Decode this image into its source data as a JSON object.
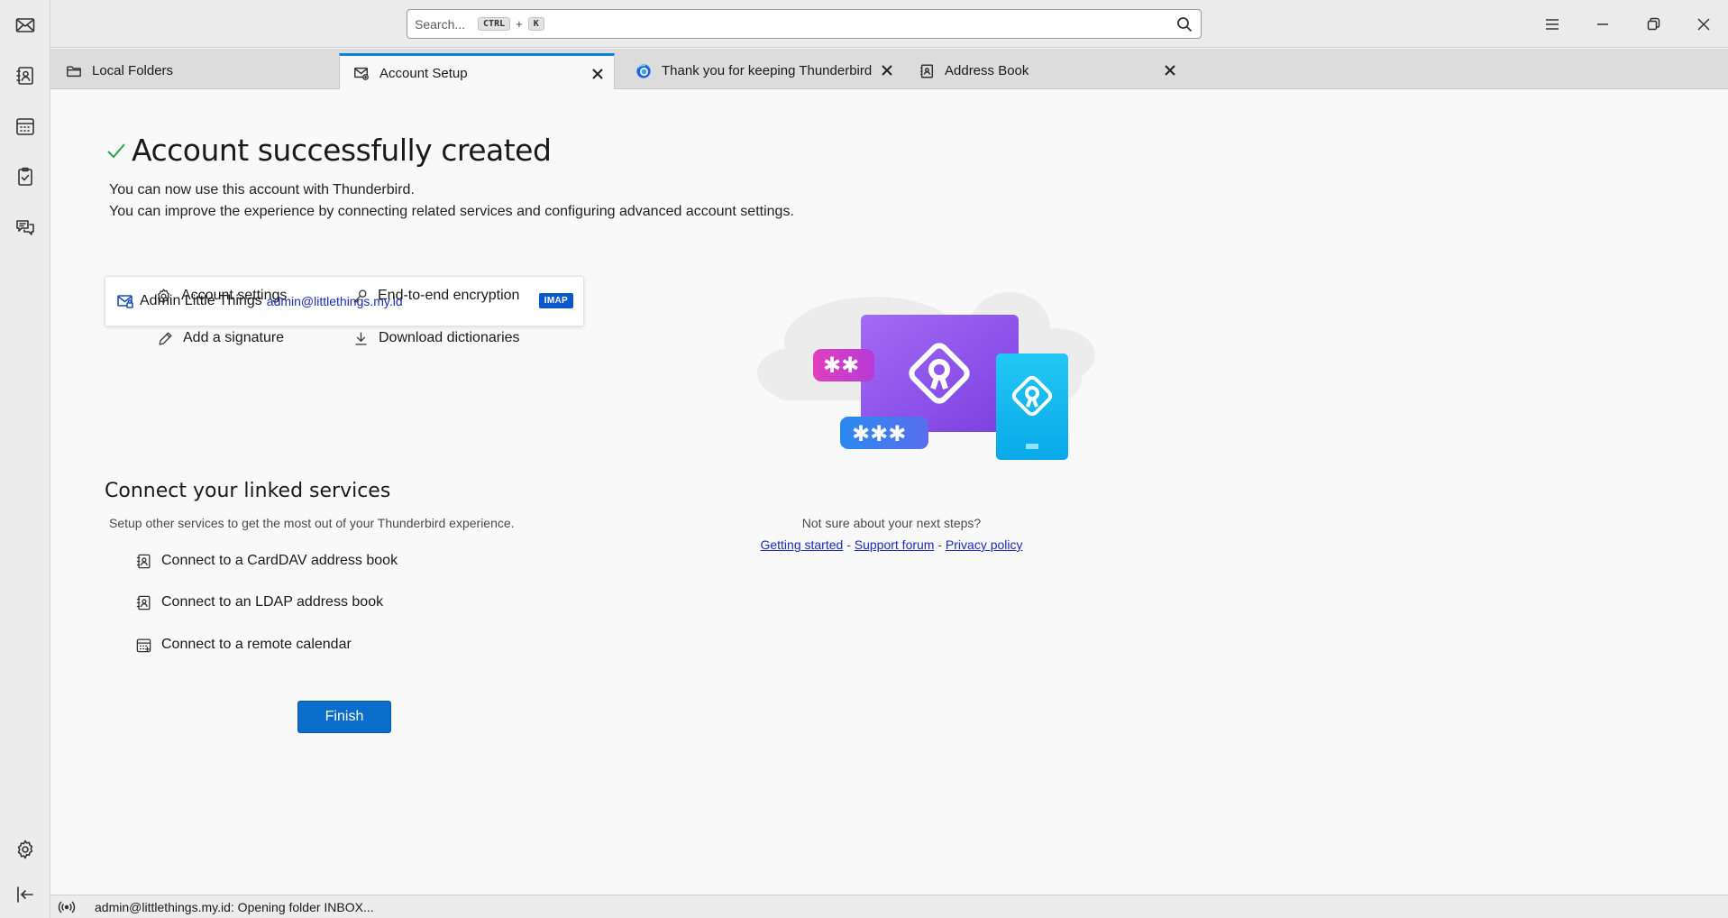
{
  "search": {
    "placeholder": "Search...",
    "shortcut_ctrl": "CTRL",
    "shortcut_plus": "+",
    "shortcut_key": "K"
  },
  "spaces": [
    {
      "name": "mail-space-button",
      "icon": "envelope-icon"
    },
    {
      "name": "address-book-space-button",
      "icon": "address-book-icon"
    },
    {
      "name": "calendar-space-button",
      "icon": "calendar-icon"
    },
    {
      "name": "tasks-space-button",
      "icon": "clipboard-check-icon"
    },
    {
      "name": "chat-space-button",
      "icon": "chat-bubbles-icon"
    },
    {
      "name": "settings-space-button",
      "icon": "gear-icon"
    },
    {
      "name": "collapse-spaces-button",
      "icon": "collapse-left-icon"
    }
  ],
  "tabs": [
    {
      "label": "Local Folders",
      "icon": "folder-icon",
      "active": false
    },
    {
      "label": "Account Setup",
      "icon": "account-setup-icon",
      "active": true
    },
    {
      "label": "Thank you for keeping Thunderbird",
      "icon": "thunderbird-logo-icon",
      "active": false
    },
    {
      "label": "Address Book",
      "icon": "address-book-icon",
      "active": false
    }
  ],
  "page": {
    "title": "Account successfully created",
    "intro_line1": "You can now use this account with Thunderbird.",
    "intro_line2": "You can improve the experience by connecting related services and configuring advanced account settings."
  },
  "account": {
    "name": "Admin Little Things",
    "email": "admin@littlethings.my.id",
    "protocol": "IMAP"
  },
  "actions": {
    "account_settings": "Account settings",
    "end_to_end": "End-to-end encryption",
    "add_signature": "Add a signature",
    "download_dictionaries": "Download dictionaries"
  },
  "linked": {
    "title": "Connect your linked services",
    "subtitle": "Setup other services to get the most out of your Thunderbird experience.",
    "carddav": "Connect to a CardDAV address book",
    "ldap": "Connect to an LDAP address book",
    "calendar": "Connect to a remote calendar"
  },
  "finish_label": "Finish",
  "help": {
    "question": "Not sure about your next steps?",
    "getting_started": "Getting started",
    "support_forum": "Support forum",
    "privacy_policy": "Privacy policy",
    "separator": "-"
  },
  "status": {
    "text": "admin@littlethings.my.id: Opening folder INBOX..."
  },
  "colors": {
    "accent": "#0a6dc9",
    "success": "#2aa54b",
    "link": "#1a2bbf",
    "imap_badge": "#0a58ca"
  }
}
